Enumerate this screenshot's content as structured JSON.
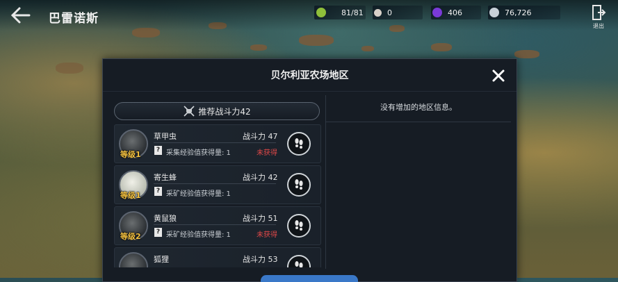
{
  "header": {
    "title": "巴雷诺斯",
    "exit_label": "退出"
  },
  "resources": [
    {
      "name": "stamina",
      "value": "81/81",
      "color": "#8fbf3a",
      "icon": "stamina-icon"
    },
    {
      "name": "orb",
      "value": "0",
      "color": "#d8d0c8",
      "icon": "orb-icon"
    },
    {
      "name": "dark-crystal",
      "value": "406",
      "color": "#7a3ad8",
      "icon": "dark-crystal-icon"
    },
    {
      "name": "silver",
      "value": "76,726",
      "color": "#c8d0d8",
      "icon": "silver-coin-icon"
    }
  ],
  "modal": {
    "title": "贝尔利亚农场地区",
    "recommended_power": "推荐战斗力42",
    "info_text": "没有增加的地区信息。",
    "monsters": [
      {
        "name": "草甲虫",
        "level": "等级1",
        "power": "战斗力 47",
        "desc": "采集经验值获得量: 1",
        "status": "未获得"
      },
      {
        "name": "寄生蜂",
        "level": "等级1",
        "power": "战斗力 42",
        "desc": "采矿经验值获得量: 1",
        "status": ""
      },
      {
        "name": "黄鼠狼",
        "level": "等级2",
        "power": "战斗力 51",
        "desc": "采矿经验值获得量: 1",
        "status": "未获得"
      },
      {
        "name": "狐狸",
        "level": "",
        "power": "战斗力 53",
        "desc": "",
        "status": ""
      }
    ]
  },
  "colors": {
    "accent_level": "#f2c040",
    "status_red": "#e04848"
  }
}
